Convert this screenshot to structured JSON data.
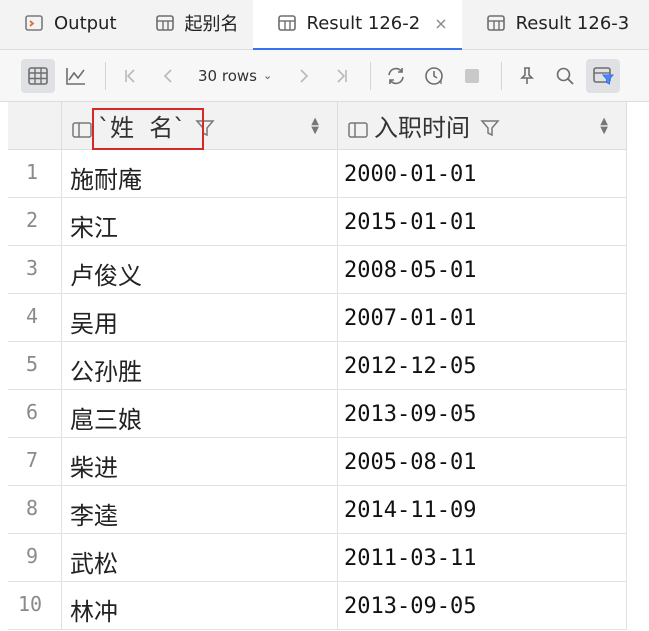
{
  "tabs": [
    {
      "label": "Output",
      "icon": "console-icon"
    },
    {
      "label": "起别名",
      "icon": "table-icon"
    },
    {
      "label": "Result 126-2",
      "icon": "table-icon",
      "active": true,
      "close": "×"
    },
    {
      "label": "Result 126-3",
      "icon": "table-icon"
    }
  ],
  "toolbar": {
    "rows_label": "30 rows",
    "rows_caret": "⌄"
  },
  "columns": [
    {
      "label": "`姓  名`"
    },
    {
      "label": "入职时间"
    }
  ],
  "rows": [
    {
      "num": "1",
      "name": "施耐庵",
      "date": "2000-01-01"
    },
    {
      "num": "2",
      "name": "宋江",
      "date": "2015-01-01"
    },
    {
      "num": "3",
      "name": "卢俊义",
      "date": "2008-05-01"
    },
    {
      "num": "4",
      "name": "吴用",
      "date": "2007-01-01"
    },
    {
      "num": "5",
      "name": "公孙胜",
      "date": "2012-12-05"
    },
    {
      "num": "6",
      "name": "扈三娘",
      "date": "2013-09-05"
    },
    {
      "num": "7",
      "name": "柴进",
      "date": "2005-08-01"
    },
    {
      "num": "8",
      "name": "李逵",
      "date": "2014-11-09"
    },
    {
      "num": "9",
      "name": "武松",
      "date": "2011-03-11"
    },
    {
      "num": "10",
      "name": "林冲",
      "date": "2013-09-05"
    }
  ],
  "colors": {
    "accent": "#3574f0",
    "highlight": "#d62828"
  }
}
